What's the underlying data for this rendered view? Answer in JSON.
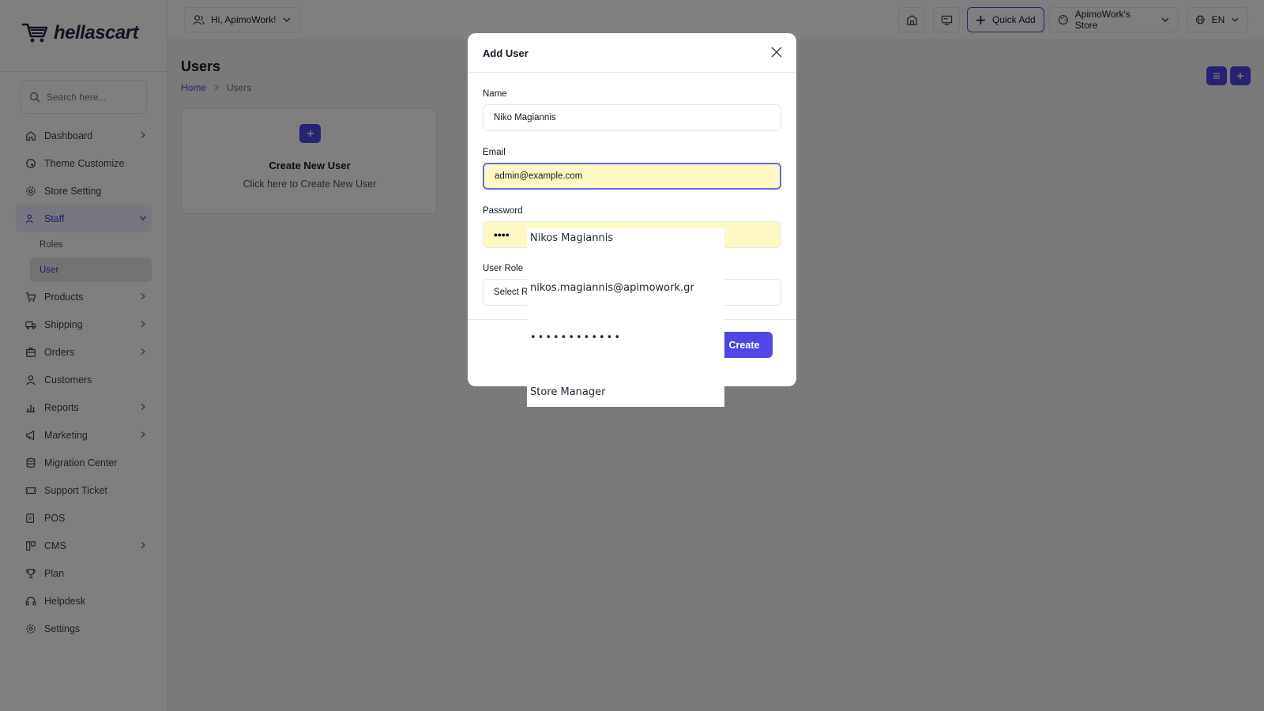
{
  "logo": {
    "text": "hellascart"
  },
  "search": {
    "placeholder": "Search here..."
  },
  "sidebar": {
    "items": [
      {
        "label": "Dashboard",
        "icon": "home-icon",
        "chevron": true
      },
      {
        "label": "Theme Customize",
        "icon": "palette-icon",
        "chevron": false
      },
      {
        "label": "Store Setting",
        "icon": "gear-icon",
        "chevron": false
      },
      {
        "label": "Staff",
        "icon": "users-icon",
        "chevron": true,
        "active": true
      },
      {
        "label": "Products",
        "icon": "cart-icon",
        "chevron": true
      },
      {
        "label": "Shipping",
        "icon": "truck-icon",
        "chevron": true
      },
      {
        "label": "Orders",
        "icon": "box-icon",
        "chevron": true
      },
      {
        "label": "Customers",
        "icon": "user-icon",
        "chevron": false
      },
      {
        "label": "Reports",
        "icon": "chart-icon",
        "chevron": true
      },
      {
        "label": "Marketing",
        "icon": "megaphone-icon",
        "chevron": true
      },
      {
        "label": "Migration Center",
        "icon": "database-icon",
        "chevron": false
      },
      {
        "label": "Support Ticket",
        "icon": "ticket-icon",
        "chevron": false
      },
      {
        "label": "POS",
        "icon": "pos-icon",
        "chevron": false
      },
      {
        "label": "CMS",
        "icon": "layout-icon",
        "chevron": true
      },
      {
        "label": "Plan",
        "icon": "trophy-icon",
        "chevron": false
      },
      {
        "label": "Helpdesk",
        "icon": "headset-icon",
        "chevron": false
      },
      {
        "label": "Settings",
        "icon": "settings-icon",
        "chevron": false
      }
    ],
    "staff_sub": [
      {
        "label": "Roles"
      },
      {
        "label": "User",
        "active": true
      }
    ]
  },
  "topbar": {
    "greeting": "Hi, ApimoWork!",
    "quick_add": "Quick Add",
    "store": "ApimoWork's Store",
    "language": "EN"
  },
  "page": {
    "title": "Users",
    "breadcrumb_home": "Home",
    "breadcrumb_current": "Users"
  },
  "card": {
    "title": "Create New User",
    "subtitle": "Click here to Create New User"
  },
  "modal": {
    "title": "Add User",
    "name_label": "Name",
    "name_value": "Niko Magiannis",
    "email_label": "Email",
    "email_value": "admin@example.com",
    "password_label": "Password",
    "password_value": "••••",
    "role_label": "User Role",
    "role_value": "Select R",
    "create_label": "Create"
  },
  "autofill": {
    "name": "Nikos Magiannis",
    "email": "nikos.magiannis@apimowork.gr",
    "password_mask": "••••••••••••",
    "role": "Store Manager"
  },
  "colors": {
    "accent": "#4f46e5",
    "autofill_bg": "#fef9c3"
  }
}
